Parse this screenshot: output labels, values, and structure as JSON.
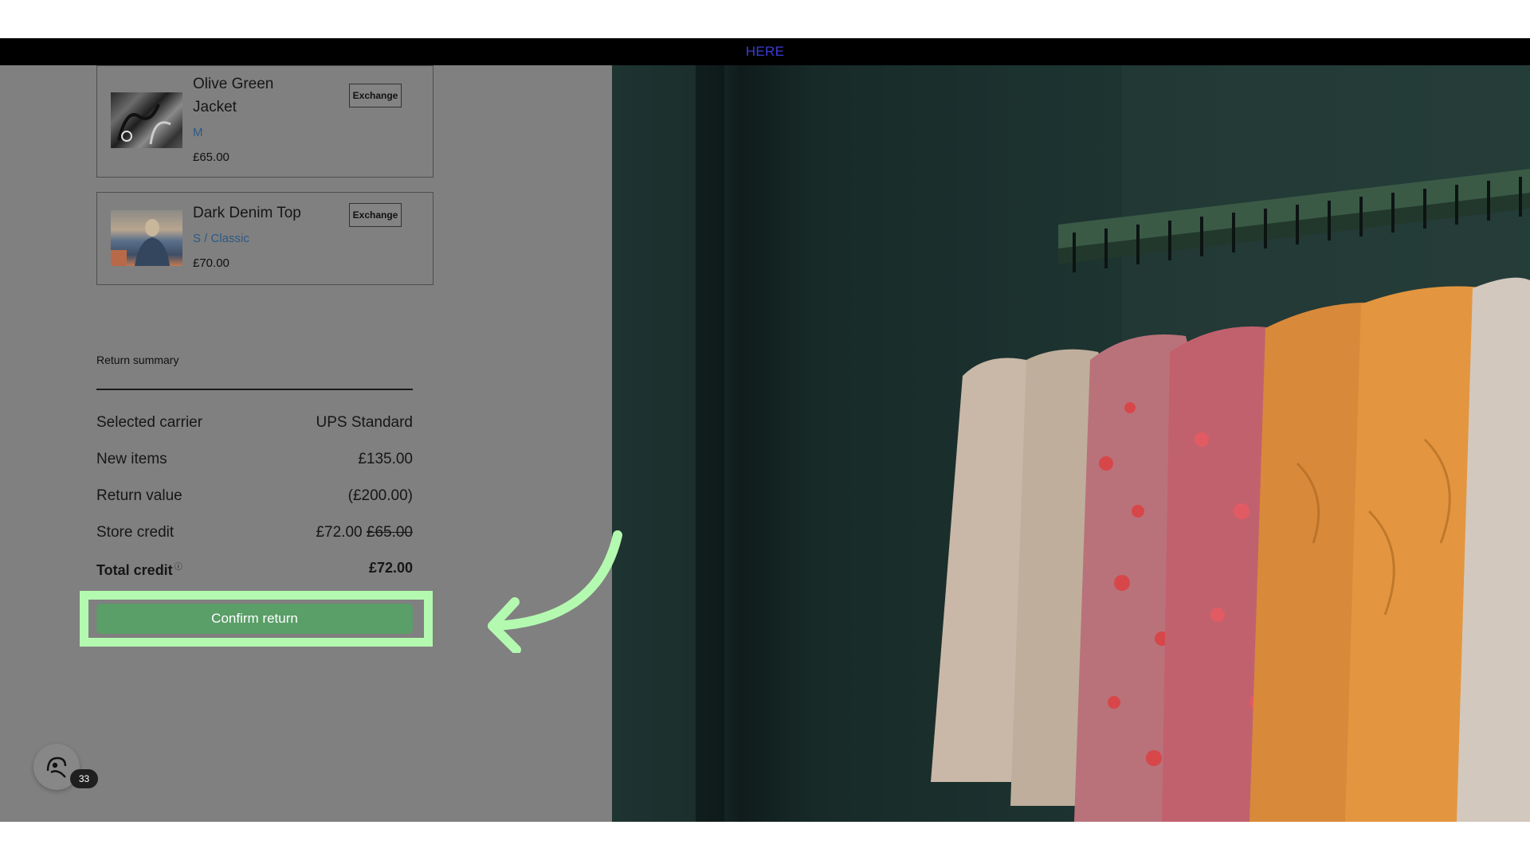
{
  "banner": {
    "link_text": "HERE"
  },
  "items": [
    {
      "name_line1": "Olive Green",
      "name_line2": "Jacket",
      "variant": "M",
      "price": "£65.00",
      "action_label": "Exchange"
    },
    {
      "name_line1": "Dark Denim Top",
      "variant": "S / Classic",
      "price": "£70.00",
      "action_label": "Exchange"
    }
  ],
  "summary": {
    "title": "Return summary",
    "rows": [
      {
        "label": "Selected carrier",
        "value": "UPS Standard"
      },
      {
        "label": "New items",
        "value": "£135.00"
      },
      {
        "label": "Return value",
        "value": "(£200.00)"
      },
      {
        "label": "Store credit",
        "value": "£72.00",
        "original_value": "£65.00"
      }
    ],
    "total": {
      "label": "Total credit",
      "value": "£72.00",
      "info_symbol": "?"
    }
  },
  "confirm_button": {
    "label": "Confirm return"
  },
  "helper_widget": {
    "icon": "helper-face-icon",
    "count": "33"
  },
  "colors": {
    "confirm": "#5a9e68",
    "highlight": "#b4f9b0",
    "variant_text": "#2a5a86"
  }
}
